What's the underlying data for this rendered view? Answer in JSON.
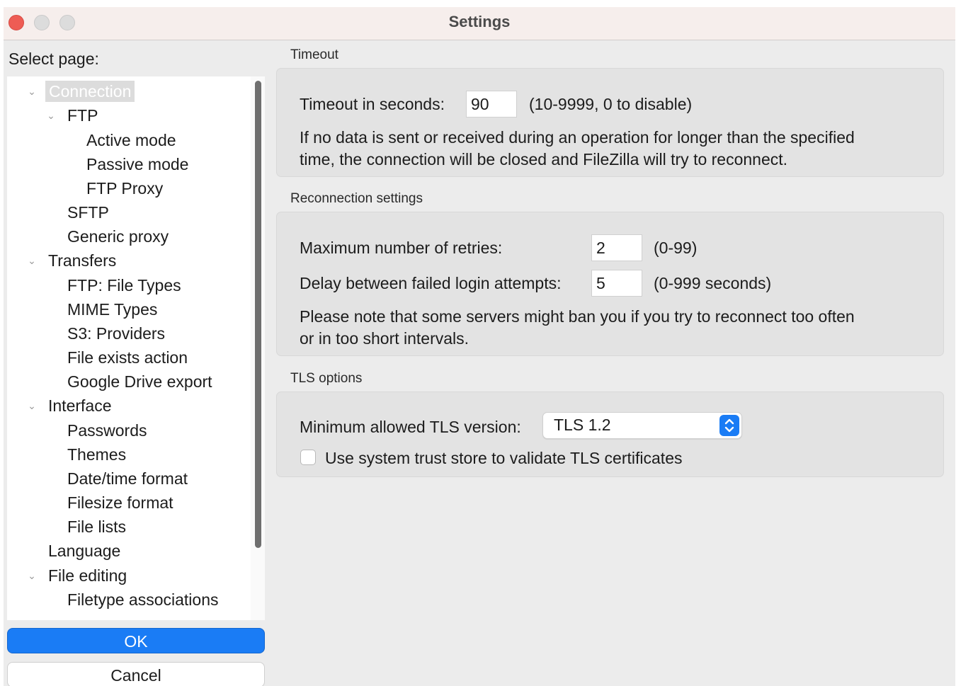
{
  "window": {
    "title": "Settings"
  },
  "sidebar": {
    "label": "Select page:",
    "tree": [
      {
        "label": "Connection",
        "expanded": true,
        "selected": true
      },
      {
        "label": "FTP",
        "expanded": true
      },
      {
        "label": "Active mode"
      },
      {
        "label": "Passive mode"
      },
      {
        "label": "FTP Proxy"
      },
      {
        "label": "SFTP"
      },
      {
        "label": "Generic proxy"
      },
      {
        "label": "Transfers",
        "expanded": true
      },
      {
        "label": "FTP: File Types"
      },
      {
        "label": "MIME Types"
      },
      {
        "label": "S3: Providers"
      },
      {
        "label": "File exists action"
      },
      {
        "label": "Google Drive export"
      },
      {
        "label": "Interface",
        "expanded": true
      },
      {
        "label": "Passwords"
      },
      {
        "label": "Themes"
      },
      {
        "label": "Date/time format"
      },
      {
        "label": "Filesize format"
      },
      {
        "label": "File lists"
      },
      {
        "label": "Language"
      },
      {
        "label": "File editing",
        "expanded": true
      },
      {
        "label": "Filetype associations"
      }
    ]
  },
  "buttons": {
    "ok": "OK",
    "cancel": "Cancel"
  },
  "timeout": {
    "group_title": "Timeout",
    "label": "Timeout in seconds:",
    "value": "90",
    "hint": "(10-9999, 0 to disable)",
    "desc_line1": "If no data is sent or received during an operation for longer than the specified",
    "desc_line2": "time, the connection will be closed and FileZilla will try to reconnect."
  },
  "reconnection": {
    "group_title": "Reconnection settings",
    "retries_label": "Maximum number of retries:",
    "retries_value": "2",
    "retries_hint": "(0-99)",
    "delay_label": "Delay between failed login attempts:",
    "delay_value": "5",
    "delay_hint": "(0-999 seconds)",
    "note_line1": "Please note that some servers might ban you if you try to reconnect too often",
    "note_line2": "or in too short intervals."
  },
  "tls": {
    "group_title": "TLS options",
    "min_version_label": "Minimum allowed TLS version:",
    "min_version_value": "TLS 1.2",
    "trust_store_label": "Use system trust store to validate TLS certificates",
    "trust_store_checked": false
  },
  "colors": {
    "accent": "#1a7cf5",
    "close": "#ee5c54",
    "titlebar": "#f6eeec"
  }
}
